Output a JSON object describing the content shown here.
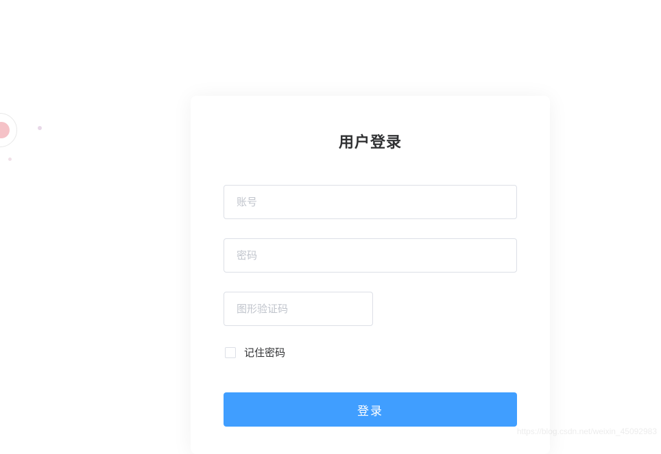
{
  "login": {
    "title": "用户登录",
    "username_placeholder": "账号",
    "password_placeholder": "密码",
    "captcha_placeholder": "图形验证码",
    "remember_label": "记住密码",
    "submit_label": "登录"
  },
  "watermark": "https://blog.csdn.net/weixin_45092983"
}
